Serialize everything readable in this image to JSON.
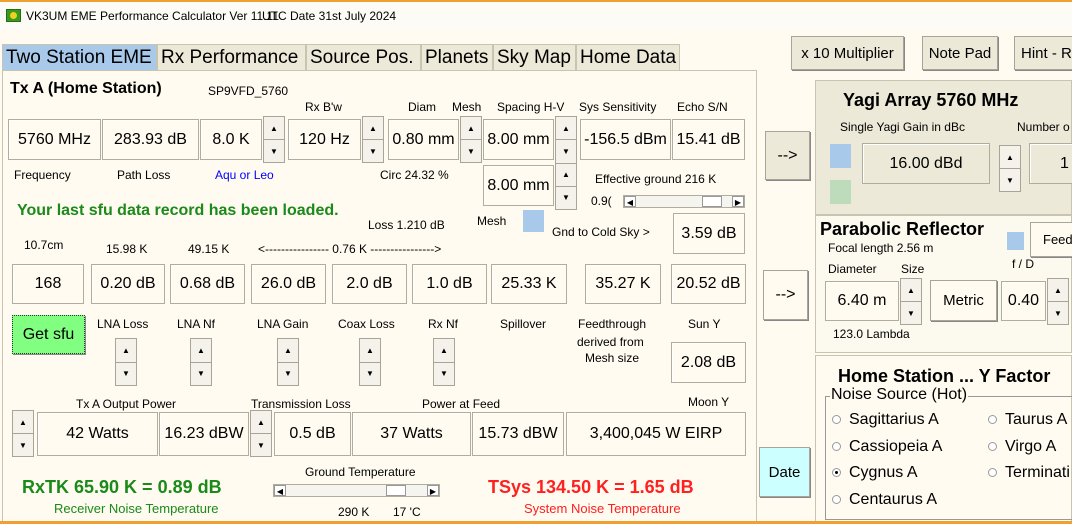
{
  "window": {
    "title": "VK3UM EME Performance Calculator Ver 11.11",
    "utc_date": "UTC Date  31st  July  2024"
  },
  "tabs": [
    {
      "label": "Two Station EME",
      "selected": true
    },
    {
      "label": "Rx Performance"
    },
    {
      "label": "Source Pos."
    },
    {
      "label": "Planets"
    },
    {
      "label": "Sky Map"
    },
    {
      "label": "Home Data"
    }
  ],
  "top_buttons": {
    "multiplier": "x 10 Multiplier",
    "notepad": "Note Pad",
    "hint": "Hint - R"
  },
  "main": {
    "heading": "Tx A (Home Station)",
    "station": "SP9VFD_5760",
    "labels": {
      "rxbw": "Rx B'w",
      "diam": "Diam",
      "mesh": "Mesh",
      "spacing": "Spacing H-V",
      "sys_sens": "Sys Sensitivity",
      "echo": "Echo S/N",
      "frequency": "Frequency",
      "path_loss": "Path Loss",
      "aqu": "Aqu or Leo",
      "circ": "Circ 24.32 %",
      "eff_ground": "Effective ground 216 K",
      "eff_val": "0.9(",
      "loss": "Loss 1.210 dB",
      "mesh2": "Mesh",
      "gnd_cold": "Gnd to Cold Sky >",
      "band": "10.7cm",
      "t1": "15.98 K",
      "t2": "49.15 K",
      "t3": "<---------------- 0.76 K ---------------->",
      "lna_loss": "LNA Loss",
      "lna_nf": "LNA Nf",
      "lna_gain": "LNA Gain",
      "coax_loss": "Coax Loss",
      "rx_nf": "Rx Nf",
      "spillover": "Spillover",
      "feed1": "Feedthrough",
      "feed2": "derived from",
      "feed3": "Mesh size",
      "sun_y": "Sun Y",
      "tx_power": "Tx A Output Power",
      "trans_loss": "Transmission Loss",
      "power_feed": "Power at Feed",
      "moon_y": "Moon Y",
      "ground_temp": "Ground Temperature",
      "gt_k": "290 K",
      "gt_c": "17 'C"
    },
    "values": {
      "freq": "5760 MHz",
      "path_loss": "283.93 dB",
      "temp": "8.0 K",
      "rxbw": "120 Hz",
      "diam": "0.80 mm",
      "spacing_h": "8.00 mm",
      "spacing_v": "8.00 mm",
      "sys_sens": "-156.5 dBm",
      "echo": "15.41 dB",
      "gnd_cold": "3.59 dB",
      "sfu": "168",
      "lna_loss": "0.20 dB",
      "lna_nf": "0.68 dB",
      "lna_gain": "26.0 dB",
      "coax_loss": "2.0 dB",
      "rx_nf": "1.0 dB",
      "spillover": "25.33 K",
      "feedthrough": "35.27 K",
      "r2last": "20.52 dB",
      "sun_y": "2.08 dB",
      "tx_watts": "42 Watts",
      "tx_dbw": "16.23 dBW",
      "trans_loss": "0.5 dB",
      "feed_watts": "37 Watts",
      "feed_dbw": "15.73 dBW",
      "eirp": "3,400,045 W EIRP"
    },
    "message": "Your last sfu data record has been loaded.",
    "get_sfu": "Get sfu",
    "rxtk": "RxTK 65.90 K = 0.89 dB",
    "rxtk_label": "Receiver Noise Temperature",
    "tsys": "TSys 134.50 K = 1.65 dB",
    "tsys_label": "System Noise Temperature"
  },
  "side": {
    "arrow1": "-->",
    "arrow2": "-->",
    "date": "Date"
  },
  "yagi": {
    "title": "Yagi Array  5760 MHz",
    "gain_label": "Single Yagi Gain in dBc",
    "number_label": "Number o",
    "gain": "16.00 dBd",
    "number": "1"
  },
  "parabolic": {
    "title": "Parabolic Reflector",
    "focal": "Focal length 2.56 m",
    "feed": "Feed",
    "diameter_label": "Diameter",
    "size_label": "Size",
    "fd_label": "f / D",
    "diameter": "6.40 m",
    "metric": "Metric",
    "fd": "0.40",
    "lambda": "123.0 Lambda"
  },
  "home": {
    "title": "Home Station ... Y Factor",
    "group": "Noise Source (Hot)",
    "sources": [
      {
        "label": "Sagittarius A"
      },
      {
        "label": "Cassiopeia A"
      },
      {
        "label": "Cygnus A",
        "selected": true
      },
      {
        "label": "Centaurus A"
      },
      {
        "label": "Taurus A"
      },
      {
        "label": "Virgo A"
      },
      {
        "label": "Terminati"
      }
    ]
  },
  "colors": {
    "green": "#1a8a1a",
    "red": "#ff2020",
    "blue_link": "#0000ff",
    "tab_selected": "#a9c9ea",
    "sfu_button": "#80ff80",
    "date_button": "#ccffff"
  }
}
